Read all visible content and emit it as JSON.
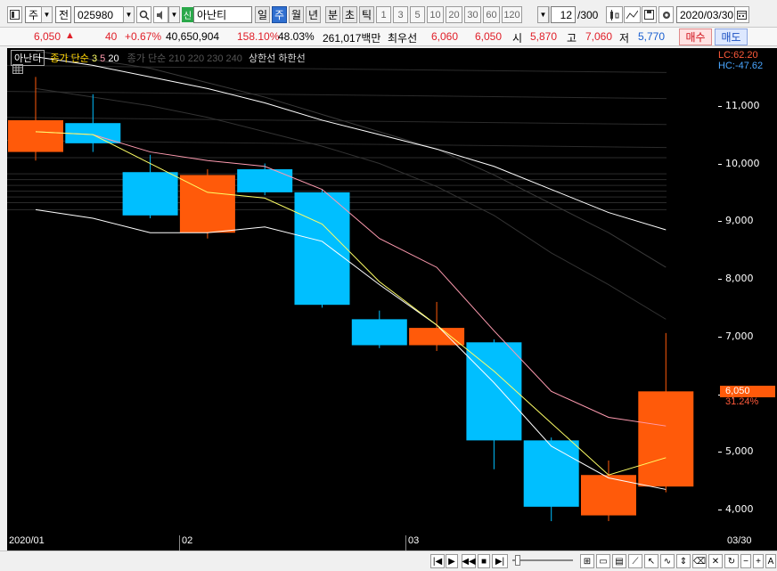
{
  "toolbar": {
    "period_type": "주",
    "market_selector": "전",
    "stock_code": "025980",
    "stock_badge": "신",
    "stock_name": "아난티",
    "period_buttons": [
      {
        "label": "일",
        "selected": false
      },
      {
        "label": "주",
        "selected": true
      },
      {
        "label": "월",
        "selected": false
      },
      {
        "label": "년",
        "selected": false
      },
      {
        "label": "분",
        "selected": false
      },
      {
        "label": "초",
        "selected": false
      },
      {
        "label": "틱",
        "selected": false
      }
    ],
    "intervals": [
      "1",
      "3",
      "5",
      "10",
      "20",
      "30",
      "60",
      "120"
    ],
    "count_value": "12",
    "count_total": "/300",
    "date": "2020/03/30",
    "icons": [
      "open-window-icon",
      "search-icon",
      "sound-icon",
      "candle-type-icon",
      "drawing-tool-icon",
      "save-icon",
      "settings-icon",
      "calendar-icon"
    ]
  },
  "quote": {
    "price": "6,050",
    "direction": "▲",
    "change": "40",
    "change_pct": "+0.67%",
    "volume": "40,650,904",
    "volume_ratio": "158.10%",
    "turnover": "48.03%",
    "amount": "261,017백만",
    "best_ask_label": "최우선",
    "best_ask": "6,060",
    "best_bid": "6,050",
    "open_label": "시",
    "open": "5,870",
    "high_label": "고",
    "high": "7,060",
    "low_label": "저",
    "low": "5,770",
    "buy_label": "매수",
    "sell_label": "매도"
  },
  "chart_meta": {
    "name_tag": "아난티",
    "ma_label": "종가 단순",
    "ma_periods": [
      "3",
      "5",
      "20"
    ],
    "vma_label": "종가 단순",
    "vma_periods": [
      "210",
      "220",
      "230",
      "240"
    ],
    "limit_labels": [
      "상한선",
      "하한선"
    ],
    "lc": "LC:62.20",
    "hc": "HC:-47.62",
    "current_price_tag": "6,050",
    "current_pct_tag": "31.24%",
    "last_date": "03/30"
  },
  "chart_data": {
    "type": "candlestick",
    "x": [
      "2020/01 W1",
      "2020/01 W2",
      "2020/01 W3",
      "2020/01 W4",
      "2020/02 W1",
      "2020/02 W2",
      "2020/02 W3",
      "2020/02 W4",
      "2020/03 W1",
      "2020/03 W2",
      "2020/03 W3",
      "2020/03 W4"
    ],
    "candles": [
      {
        "open": 10200,
        "high": 11500,
        "low": 10050,
        "close": 10750
      },
      {
        "open": 10700,
        "high": 11200,
        "low": 10200,
        "close": 10350
      },
      {
        "open": 9850,
        "high": 10150,
        "low": 9050,
        "close": 9100
      },
      {
        "open": 8800,
        "high": 9900,
        "low": 8700,
        "close": 9800
      },
      {
        "open": 9900,
        "high": 10000,
        "low": 9450,
        "close": 9500
      },
      {
        "open": 9500,
        "high": 9550,
        "low": 7500,
        "close": 7550
      },
      {
        "open": 7300,
        "high": 7450,
        "low": 6800,
        "close": 6850
      },
      {
        "open": 6850,
        "high": 7600,
        "low": 6750,
        "close": 7150
      },
      {
        "open": 6900,
        "high": 6950,
        "low": 4700,
        "close": 5200
      },
      {
        "open": 5200,
        "high": 5250,
        "low": 3800,
        "close": 4050
      },
      {
        "open": 3900,
        "high": 4850,
        "low": 3800,
        "close": 4600
      },
      {
        "open": 4400,
        "high": 7060,
        "low": 4300,
        "close": 6050
      }
    ],
    "ma3": [
      10550,
      10500,
      10000,
      9500,
      9400,
      8950,
      7950,
      7200,
      6400,
      5500,
      4600,
      4900
    ],
    "ma5": [
      10550,
      10500,
      10200,
      10050,
      9950,
      9550,
      8700,
      8200,
      7100,
      6050,
      5600,
      5450
    ],
    "ma20": [
      11850,
      11700,
      11500,
      11300,
      11050,
      10750,
      10500,
      10250,
      9950,
      9550,
      9150,
      8850
    ],
    "ma_other": [
      9200,
      9050,
      8800,
      8800,
      8900,
      8650,
      7900,
      7200,
      6200,
      5100,
      4550,
      4350
    ],
    "ylim": [
      3600,
      12000
    ],
    "yticks": [
      "11,000",
      "10,000",
      "9,000",
      "8,000",
      "7,000",
      "6,000",
      "5,000",
      "4,000"
    ],
    "xticks": [
      "2020/01",
      "02",
      "03"
    ],
    "up_color": "#ff5a0a",
    "down_color": "#00bfff",
    "ma3_color": "#ffff66",
    "ma5_color": "#ff9bb0",
    "ma20_color": "#ffffff"
  }
}
